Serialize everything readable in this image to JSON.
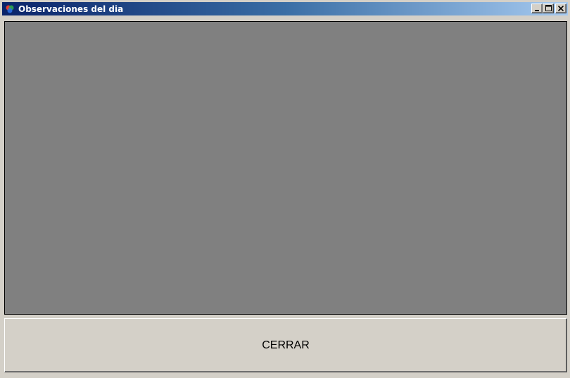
{
  "window": {
    "title": "Observaciones del dia",
    "app_icon": "app-logo-icon",
    "controls": {
      "minimize_icon": "minimize-icon",
      "maximize_icon": "maximize-icon",
      "close_icon": "close-icon"
    }
  },
  "main": {
    "observations_panel": {
      "content": ""
    },
    "close_button_label": "CERRAR"
  },
  "colors": {
    "titlebar_start": "#0a246a",
    "titlebar_end": "#a6caf0",
    "panel_background": "#808080",
    "window_background": "#d4d0c8"
  }
}
